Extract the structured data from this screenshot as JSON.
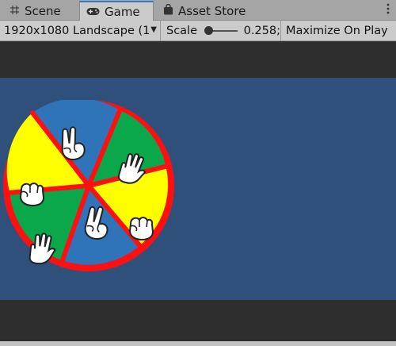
{
  "tabs": {
    "scene": {
      "label": "Scene",
      "icon": "grid-icon"
    },
    "game": {
      "label": "Game",
      "icon": "gamepad-icon"
    },
    "asset_store": {
      "label": "Asset Store",
      "icon": "shopping-bag-icon"
    },
    "menu_icon": "kebab-menu-icon"
  },
  "toolbar": {
    "resolution": "1920x1080 Landscape (1",
    "scale_label": "Scale",
    "scale_value": "0.258;",
    "maximize_on_play": "Maximize On Play"
  },
  "colors": {
    "viewport_bg": "#30507c",
    "wheel_rim": "#ff1010",
    "segment_blue": "#2f73b8",
    "segment_green": "#0aa84b",
    "segment_yellow": "#ffff00"
  },
  "wheel": {
    "segments": [
      {
        "color": "blue",
        "icon": "peace-hand-icon"
      },
      {
        "color": "green",
        "icon": "open-hand-icon"
      },
      {
        "color": "yellow",
        "icon": "fist-icon"
      },
      {
        "color": "blue",
        "icon": "peace-hand-icon"
      },
      {
        "color": "green",
        "icon": "open-hand-icon"
      },
      {
        "color": "yellow",
        "icon": "fist-icon"
      }
    ]
  }
}
